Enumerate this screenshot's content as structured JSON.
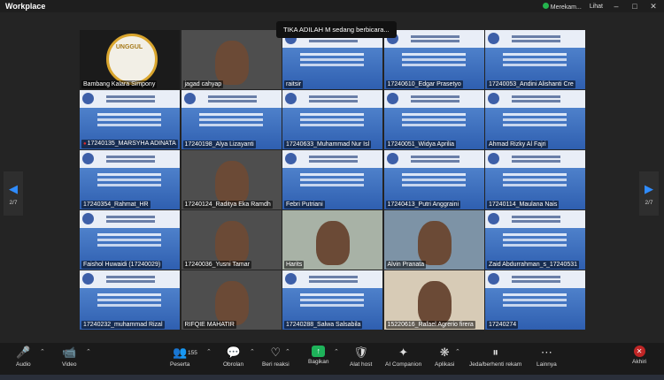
{
  "window": {
    "title": "Workplace",
    "rec_label": "Merekam...",
    "view_label": "Lihat"
  },
  "speaking_banner": "TIKA ADILAH M sedang berbicara...",
  "pagination": {
    "prev_label": "2/7",
    "next_label": "2/7"
  },
  "participants": [
    {
      "name": "Bambang Kalara Simpony",
      "kind": "award",
      "badge": "UNGGUL"
    },
    {
      "name": "jagad cahyap",
      "kind": "cam"
    },
    {
      "name": "raitsir",
      "kind": "slide"
    },
    {
      "name": "17240610_Edgar Prasetyo",
      "kind": "slide"
    },
    {
      "name": "17240053_Andini Alishanti Cre",
      "kind": "slide"
    },
    {
      "name": "17240135_MARSYHA ADINATA",
      "kind": "slide",
      "muted": true
    },
    {
      "name": "17240198_Alya Lizayanti",
      "kind": "slide"
    },
    {
      "name": "17240633_Muhammad Nur Isl",
      "kind": "slide"
    },
    {
      "name": "17240051_Widya Aprilia",
      "kind": "slide"
    },
    {
      "name": "Ahmad Rizky Al Fajri",
      "kind": "slide"
    },
    {
      "name": "17240354_Rahmat_HR",
      "kind": "slide"
    },
    {
      "name": "17240124_Raditya Eka Ramdh",
      "kind": "cam"
    },
    {
      "name": "Febri Putriani",
      "kind": "slide"
    },
    {
      "name": "17240413_Putri Anggraini",
      "kind": "slide"
    },
    {
      "name": "17240114_Maulana Nais",
      "kind": "slide"
    },
    {
      "name": "Faishol Huwaidi (17240029)",
      "kind": "slide"
    },
    {
      "name": "17240036_Yusni Tamar",
      "kind": "cam"
    },
    {
      "name": "Harits",
      "kind": "cam-light"
    },
    {
      "name": "Alvin Pranata",
      "kind": "cam-blue"
    },
    {
      "name": "Zaid Abdurrahman_s_17240531",
      "kind": "slide"
    },
    {
      "name": "17240232_muhammad Rizal",
      "kind": "slide"
    },
    {
      "name": "RIFQIE MAHATIR",
      "kind": "cam"
    },
    {
      "name": "17240288_Salwa Salsabila",
      "kind": "slide"
    },
    {
      "name": "15220616_Rafael Agrerio firera",
      "kind": "cam-beige"
    },
    {
      "name": "17240274",
      "kind": "slide"
    }
  ],
  "toolbar": {
    "audio": "Audio",
    "video": "Video",
    "participants": "Peserta",
    "participant_count": "155",
    "chat": "Obrolan",
    "reactions": "Beri reaksi",
    "share": "Bagikan",
    "host_tools": "Alat host",
    "ai_companion": "AI Companion",
    "apps": "Aplikasi",
    "pause_record": "Jeda/berhenti rekam",
    "more": "Lainnya",
    "exit": "Akhiri"
  }
}
